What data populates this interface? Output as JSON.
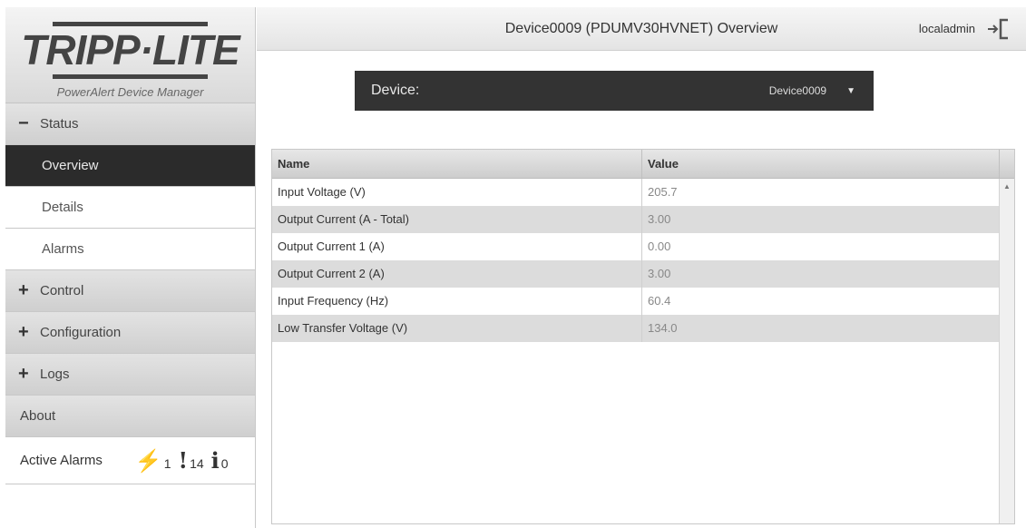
{
  "app": {
    "brand": "TRIPP·LITE",
    "tagline": "PowerAlert Device Manager"
  },
  "header": {
    "title": "Device0009 (PDUMV30HVNET) Overview",
    "user": "localadmin",
    "logout_icon": "logout-icon"
  },
  "sidebar": {
    "status": {
      "sign": "−",
      "label": "Status"
    },
    "status_items": [
      {
        "label": "Overview",
        "active": true
      },
      {
        "label": "Details"
      },
      {
        "label": "Alarms"
      }
    ],
    "groups": [
      {
        "sign": "+",
        "label": "Control"
      },
      {
        "sign": "+",
        "label": "Configuration"
      },
      {
        "sign": "+",
        "label": "Logs"
      }
    ],
    "about": "About",
    "active_alarms": {
      "label": "Active Alarms",
      "critical": {
        "symbol": "⚡",
        "count": "1"
      },
      "warning": {
        "symbol": "!",
        "count": "14"
      },
      "info": {
        "symbol": "i",
        "count": "0"
      }
    }
  },
  "device_selector": {
    "label": "Device:",
    "value": "Device0009",
    "caret": "▼"
  },
  "table": {
    "columns": [
      "Name",
      "Value"
    ],
    "rows": [
      {
        "name": "Input Voltage (V)",
        "value": "205.7"
      },
      {
        "name": "Output Current (A - Total)",
        "value": "3.00"
      },
      {
        "name": "Output Current 1 (A)",
        "value": "0.00"
      },
      {
        "name": "Output Current 2 (A)",
        "value": "3.00"
      },
      {
        "name": "Input Frequency (Hz)",
        "value": "60.4"
      },
      {
        "name": "Low Transfer Voltage (V)",
        "value": "134.0"
      }
    ],
    "scroll_up": "▲"
  }
}
